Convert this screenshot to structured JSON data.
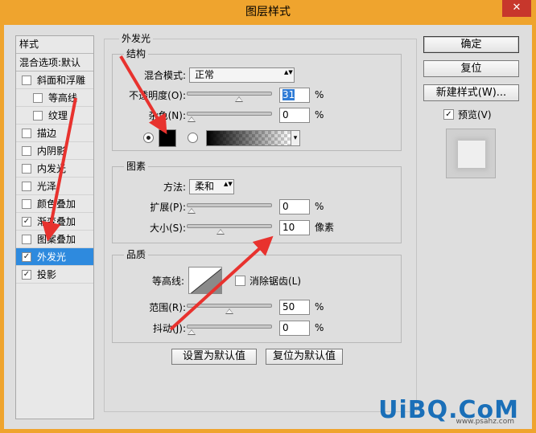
{
  "window": {
    "title": "图层样式",
    "close_glyph": "✕"
  },
  "style_list": {
    "header": "样式",
    "blending": "混合选项:默认",
    "items": [
      {
        "label": "斜面和浮雕",
        "checked": false,
        "indent": false
      },
      {
        "label": "等高线",
        "checked": false,
        "indent": true
      },
      {
        "label": "纹理",
        "checked": false,
        "indent": true
      },
      {
        "label": "描边",
        "checked": false,
        "indent": false
      },
      {
        "label": "内阴影",
        "checked": false,
        "indent": false
      },
      {
        "label": "内发光",
        "checked": false,
        "indent": false
      },
      {
        "label": "光泽",
        "checked": false,
        "indent": false
      },
      {
        "label": "颜色叠加",
        "checked": false,
        "indent": false
      },
      {
        "label": "渐变叠加",
        "checked": true,
        "indent": false
      },
      {
        "label": "图案叠加",
        "checked": false,
        "indent": false
      },
      {
        "label": "外发光",
        "checked": true,
        "indent": false,
        "active": true
      },
      {
        "label": "投影",
        "checked": true,
        "indent": false
      }
    ],
    "check_glyph": "✓"
  },
  "outer_glow": {
    "title": "外发光",
    "structure": {
      "title": "结构",
      "blend_mode_label": "混合模式:",
      "blend_mode_value": "正常",
      "opacity_label": "不透明度(O):",
      "opacity_value": "31",
      "opacity_unit": "%",
      "opacity_fraction": 0.31,
      "noise_label": "杂色(N):",
      "noise_value": "0",
      "noise_unit": "%",
      "noise_fraction": 0.0,
      "glow_color": "#000000"
    },
    "elements": {
      "title": "图素",
      "technique_label": "方法:",
      "technique_value": "柔和",
      "spread_label": "扩展(P):",
      "spread_value": "0",
      "spread_unit": "%",
      "spread_fraction": 0.0,
      "size_label": "大小(S):",
      "size_value": "10",
      "size_unit": "像素",
      "size_fraction": 0.06
    },
    "quality": {
      "title": "品质",
      "contour_label": "等高线:",
      "antialias_label": "消除锯齿(L)",
      "range_label": "范围(R):",
      "range_value": "50",
      "range_unit": "%",
      "range_fraction": 0.5,
      "jitter_label": "抖动(J):",
      "jitter_value": "0",
      "jitter_unit": "%",
      "jitter_fraction": 0.0
    },
    "make_default": "设置为默认值",
    "reset_default": "复位为默认值"
  },
  "buttons": {
    "ok": "确定",
    "reset": "复位",
    "new_style": "新建样式(W)...",
    "preview_label": "预览(V)",
    "preview_checked": true
  },
  "watermark": {
    "brand": "UiBQ.CoM",
    "site": "www.psahz.com"
  },
  "colors": {
    "arrow": "#e8322e",
    "selection": "#2e8ade",
    "titlebar": "#efa42e"
  },
  "icons": {
    "dropdown": "▲▼",
    "small_dropdown": "▾"
  }
}
